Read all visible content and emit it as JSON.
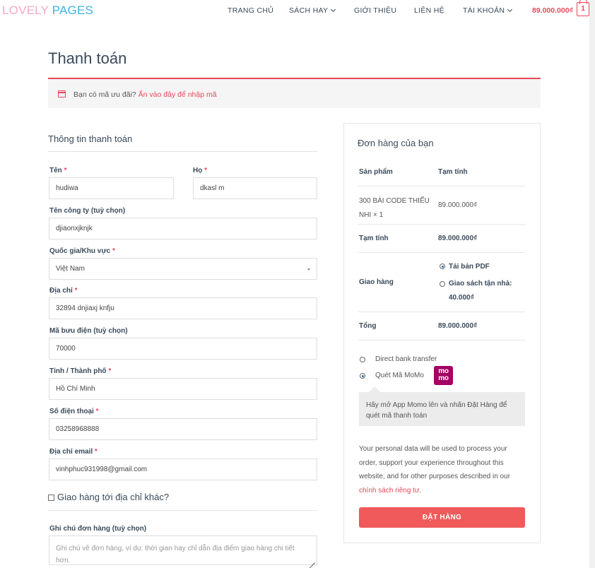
{
  "header": {
    "logo_part1": "LOVELY",
    "logo_part2": "PAGES",
    "nav": [
      "TRANG CHỦ",
      "SÁCH HAY",
      "GIỚI THIỆU",
      "LIÊN HỆ",
      "TÀI KHOẢN"
    ],
    "cart_total": "89.000.000₫",
    "cart_count": "1"
  },
  "page_title": "Thanh toán",
  "coupon": {
    "text": "Bạn có mã ưu đãi?",
    "link": "Ấn vào đây để nhập mã"
  },
  "billing": {
    "title": "Thông tin thanh toán",
    "first_name": {
      "label": "Tên",
      "req": "*",
      "value": "hudiwa"
    },
    "last_name": {
      "label": "Họ",
      "req": "*",
      "value": "dkasl m"
    },
    "company": {
      "label": "Tên công ty (tuỳ chọn)",
      "value": "djiaonxjknjk"
    },
    "country": {
      "label": "Quốc gia/Khu vực",
      "req": "*",
      "value": "Việt Nam"
    },
    "address": {
      "label": "Địa chỉ",
      "req": "*",
      "value": "32894 dnjiaxj knfju"
    },
    "postcode": {
      "label": "Mã bưu điện (tuỳ chọn)",
      "value": "70000"
    },
    "city": {
      "label": "Tỉnh / Thành phố",
      "req": "*",
      "value": "Hồ Chí Minh"
    },
    "phone": {
      "label": "Số điện thoại",
      "req": "*",
      "value": "03258968888"
    },
    "email": {
      "label": "Địa chỉ email",
      "req": "*",
      "value": "vinhphuc931998@gmail.com"
    },
    "ship_different": "Giao hàng tới địa chỉ khác?",
    "notes": {
      "label": "Ghi chú đơn hàng (tuỳ chọn)",
      "placeholder": "Ghi chú về đơn hàng, ví dụ: thời gian hay chỉ dẫn địa điểm giao hàng chi tiết hơn."
    }
  },
  "order": {
    "title": "Đơn hàng của bạn",
    "col_product": "Sản phẩm",
    "col_subtotal": "Tạm tính",
    "product_line1": "300 BÀI CODE THIẾU",
    "product_line2": "NHI",
    "product_qty": "× 1",
    "product_price": "89.000.000₫",
    "subtotal_label": "Tạm tính",
    "subtotal_value": "89.000.000₫",
    "shipping_label": "Giao hàng",
    "shipping_opt1": "Tải bản PDF",
    "shipping_opt2": "Giao sách tận nhà:",
    "shipping_opt2_price": "40.000₫",
    "total_label": "Tổng",
    "total_value": "89.000.000₫",
    "payment_bank": "Direct bank transfer",
    "payment_momo": "Quét Mã MoMo",
    "momo_logo_line1": "mo",
    "momo_logo_line2": "mo",
    "momo_desc": "Hãy mở App Momo lên và nhấn Đặt Hàng để quét mã thanh toán",
    "privacy_text": "Your personal data will be used to process your order, support your experience throughout this website, and for other purposes described in our",
    "privacy_link": "chính sách riêng tư",
    "privacy_end": ".",
    "place_order": "ĐẶT HÀNG"
  },
  "colors": {
    "accent": "#e8475a",
    "momo": "#a50064",
    "button": "#f05a5a"
  }
}
